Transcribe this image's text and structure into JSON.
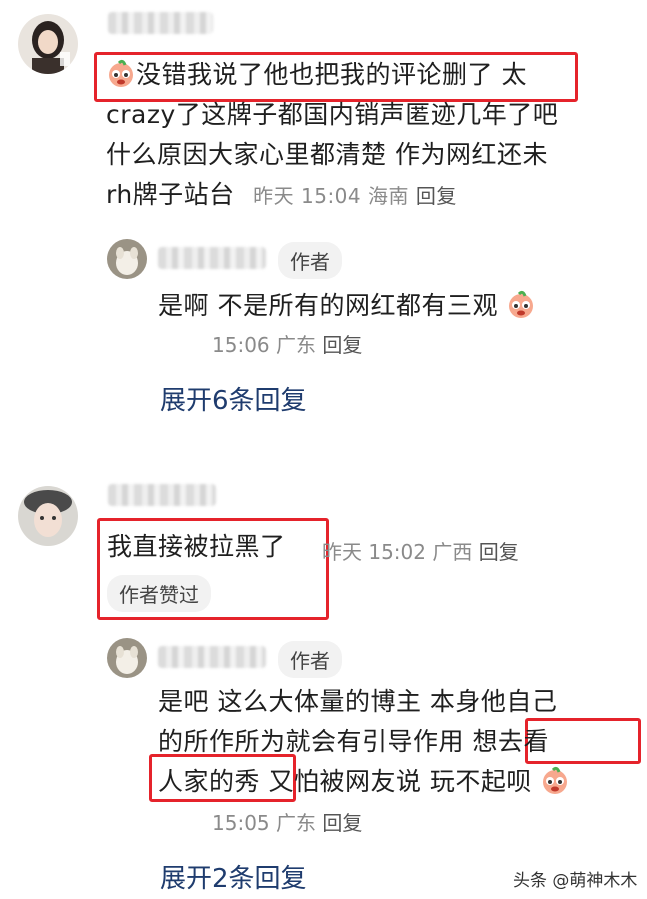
{
  "colors": {
    "highlight_box": "#e5232b",
    "link": "#1f3c6e",
    "meta_gray": "#8a8a8a"
  },
  "comment1": {
    "avatar_icon": "woman-avatar-icon",
    "emoji_icon": "crying-peach-emoji-icon",
    "lines": [
      "没错我说了他也把我的评论删了 太",
      "crazy了这牌子都国内销声匿迹几年了吧",
      "什么原因大家心里都清楚 作为网红还未",
      "rh牌子站台"
    ],
    "time": "昨天 15:04",
    "location": "海南",
    "reply_label": "回复"
  },
  "reply1": {
    "avatar_icon": "dog-avatar-icon",
    "author_tag": "作者",
    "text": "是啊 不是所有的网红都有三观",
    "emoji_icon": "crying-peach-emoji-icon",
    "time": "15:06",
    "location": "广东",
    "reply_label": "回复"
  },
  "expand1": "展开6条回复",
  "comment2": {
    "avatar_icon": "girl-hat-avatar-icon",
    "text": "我直接被拉黑了",
    "time": "昨天 15:02",
    "location": "广西",
    "reply_label": "回复",
    "liked_tag": "作者赞过"
  },
  "reply2": {
    "avatar_icon": "dog-avatar-icon",
    "author_tag": "作者",
    "lines": [
      "是吧 这么大体量的博主 本身他自己",
      "的所作所为就会有引导作用 想去看",
      "人家的秀 又怕被网友说 玩不起呗"
    ],
    "emoji_icon": "crying-peach-emoji-icon",
    "time": "15:05",
    "location": "广东",
    "reply_label": "回复"
  },
  "expand2": "展开2条回复",
  "watermark": "头条 @萌神木木"
}
